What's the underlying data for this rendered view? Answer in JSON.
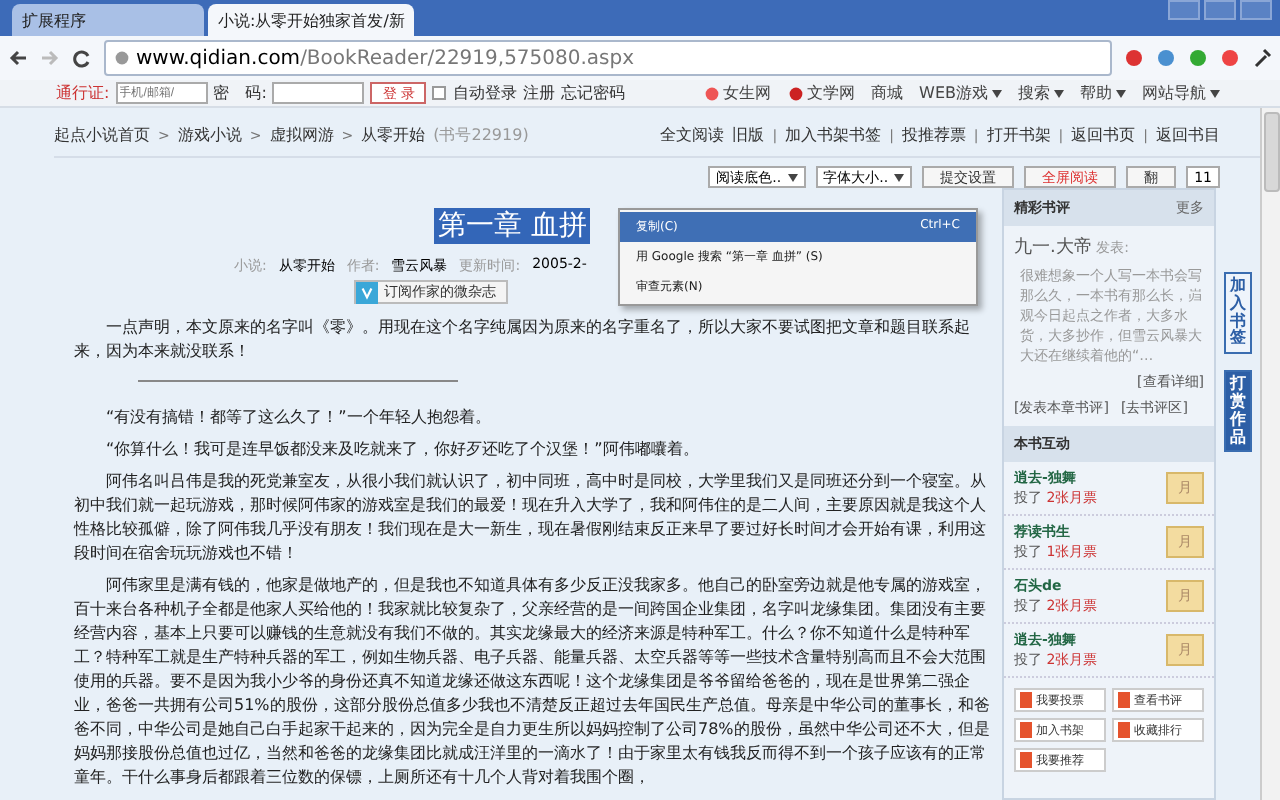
{
  "browser": {
    "tabs": [
      {
        "label": "扩展程序",
        "selected": false
      },
      {
        "label": "小说:从零开始独家首发/新",
        "selected": true
      }
    ],
    "url_host": "www.qidian.com",
    "url_path": "/BookReader/22919,575080.aspx"
  },
  "login_bar": {
    "passport_label": "通行证:",
    "passport_placeholder": "手机/邮箱/",
    "password_label": "密　码:",
    "login_button": "登 录",
    "auto_login": {
      "label": "自动登录",
      "checked": false
    },
    "register": "注册",
    "forgot": "忘记密码",
    "site_links": [
      {
        "label": "女生网",
        "kind": "logo"
      },
      {
        "label": "文学网",
        "kind": "logo"
      },
      {
        "label": "商城",
        "kind": "plain"
      },
      {
        "label": "WEB游戏",
        "kind": "menu"
      },
      {
        "label": "搜索",
        "kind": "menu"
      },
      {
        "label": "帮助",
        "kind": "menu"
      },
      {
        "label": "网站导航",
        "kind": "menu"
      }
    ]
  },
  "breadcrumb": {
    "items": [
      {
        "kind": "link",
        "label": "起点小说首页"
      },
      {
        "kind": "sep",
        "label": ">"
      },
      {
        "kind": "link",
        "label": "游戏小说"
      },
      {
        "kind": "sep",
        "label": ">"
      },
      {
        "kind": "link",
        "label": "虚拟网游"
      },
      {
        "kind": "sep",
        "label": ">"
      },
      {
        "kind": "link",
        "label": "从零开始"
      }
    ],
    "book_no": "(书号22919)"
  },
  "top_links": [
    {
      "kind": "link",
      "label": "全文阅读"
    },
    {
      "kind": "link",
      "label": "旧版"
    },
    {
      "kind": "sep",
      "label": "|"
    },
    {
      "kind": "link",
      "label": "加入书架书签"
    },
    {
      "kind": "sep",
      "label": "|"
    },
    {
      "kind": "link",
      "label": "投推荐票"
    },
    {
      "kind": "sep",
      "label": "|"
    },
    {
      "kind": "link",
      "label": "打开书架"
    },
    {
      "kind": "sep",
      "label": "|"
    },
    {
      "kind": "link",
      "label": "返回书页"
    },
    {
      "kind": "sep",
      "label": "|"
    },
    {
      "kind": "link",
      "label": "返回书目"
    }
  ],
  "settings": {
    "bg_select": "阅读底色..",
    "font_select": "字体大小..",
    "submit": "提交设置",
    "fullscreen": "全屏阅读",
    "flip": "翻",
    "page": "11"
  },
  "chapter": {
    "title": "第一章 血拼",
    "title_selected": true,
    "meta": [
      {
        "label": "小说:",
        "value": "从零开始"
      },
      {
        "label": "作者:",
        "value": "雪云风暴"
      },
      {
        "label": "更新时间:",
        "value": "2005-2-"
      }
    ],
    "subscribe": "订阅作家的微杂志"
  },
  "context_menu": [
    {
      "label": "复制(C)",
      "shortcut": "Ctrl+C",
      "selected": true
    },
    {
      "label": "用 Google 搜索 “第一章 血拼” (S)",
      "selected": false
    },
    {
      "label": "审查元素(N)",
      "selected": false
    }
  ],
  "paragraphs": [
    {
      "kind": "note",
      "text": "一点声明，本文原来的名字叫《零》。用现在这个名字纯属因为原来的名字重名了，所以大家不要试图把文章和题目联系起来，因为本来就没联系！"
    },
    {
      "kind": "divider"
    },
    {
      "kind": "text",
      "text": "“有没有搞错！都等了这么久了！”一个年轻人抱怨着。"
    },
    {
      "kind": "text",
      "text": "“你算什么！我可是连早饭都没来及吃就来了，你好歹还吃了个汉堡！”阿伟嘟囔着。"
    },
    {
      "kind": "text",
      "text": "阿伟名叫吕伟是我的死党兼室友，从很小我们就认识了，初中同班，高中时是同校，大学里我们又是同班还分到一个寝室。从初中我们就一起玩游戏，那时候阿伟家的游戏室是我们的最爱！现在升入大学了，我和阿伟住的是二人间，主要原因就是我这个人性格比较孤僻，除了阿伟我几乎没有朋友！我们现在是大一新生，现在暑假刚结束反正来早了要过好长时间才会开始有课，利用这段时间在宿舍玩玩游戏也不错！"
    },
    {
      "kind": "text",
      "text": "阿伟家里是满有钱的，他家是做地产的，但是我也不知道具体有多少反正没我家多。他自己的卧室旁边就是他专属的游戏室，百十来台各种机子全都是他家人买给他的！我家就比较复杂了，父亲经营的是一间跨国企业集团，名字叫龙缘集团。集团没有主要经营内容，基本上只要可以赚钱的生意就没有我们不做的。其实龙缘最大的经济来源是特种军工。什么？你不知道什么是特种军工？特种军工就是生产特种兵器的军工，例如生物兵器、电子兵器、能量兵器、太空兵器等等一些技术含量特别高而且不会大范围使用的兵器。要不是因为我小少爷的身份还真不知道龙缘还做这东西呢！这个龙缘集团是爷爷留给爸爸的，现在是世界第二强企业，爸爸一共拥有公司51%的股份，这部分股份总值多少我也不清楚反正超过去年国民生产总值。母亲是中华公司的董事长，和爸爸不同，中华公司是她自己白手起家干起来的，因为完全是自力更生所以妈妈控制了公司78%的股份，虽然中华公司还不大，但是妈妈那接股份总值也过亿，当然和爸爸的龙缘集团比就成汪洋里的一滴水了！由于家里太有钱我反而得不到一个孩子应该有的正常童年。干什么事身后都跟着三位数的保镖，上厕所还有十几个人背对着我围个圈，"
    }
  ],
  "reviews": {
    "title": "精彩书评",
    "more": "更多",
    "author": "九一.大帝",
    "posted": "发表:",
    "body": "很难想象一个人写一本书会写那么久，一本书有那么长，岿观今日起点之作者，大多水货，大多抄作，但雪云风暴大大还在继续着他的“…",
    "detail": "[查看详细]",
    "post": "[发表本章书评]",
    "forum": "[去书评区]"
  },
  "interaction": {
    "title": "本书互动",
    "entries": [
      {
        "user": "逍去-独舞",
        "action": "投了",
        "tickets": "2张月票",
        "badge": "月"
      },
      {
        "user": "荐读书生",
        "action": "投了",
        "tickets": "1张月票",
        "badge": "月"
      },
      {
        "user": "石头de",
        "action": "投了",
        "tickets": "2张月票",
        "badge": "月"
      },
      {
        "user": "逍去-独舞",
        "action": "投了",
        "tickets": "2张月票",
        "badge": "月"
      }
    ],
    "buttons": [
      "我要投票",
      "查看书评",
      "加入书架",
      "收藏排行",
      "我要推荐"
    ]
  },
  "float_buttons": [
    {
      "label": "加入书签",
      "kind": "outline"
    },
    {
      "label": "打赏作品",
      "kind": "filled"
    }
  ]
}
